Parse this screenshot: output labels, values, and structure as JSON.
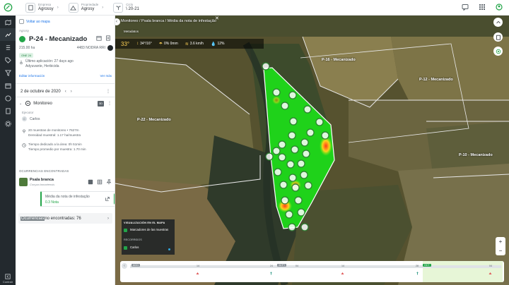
{
  "topbar": {
    "company_label": "Empresa",
    "company_value": "Agrossy",
    "property_label": "Propriedade",
    "property_value": "Agrosy",
    "cycle_label": "Ciclo",
    "cycle_value": "\\ 20-21"
  },
  "leftnav": {
    "collapse_label": "Contrair"
  },
  "panel": {
    "back_label": "Voltar ao mapa",
    "company": "Agrosy",
    "field_name": "P-24 - Mecanizado",
    "area": "215.00 ha",
    "variety": "4483 NODRA RRI",
    "badge": "ONE 24",
    "last_application_label": "Último aplicación: 27 days ago",
    "last_application_detail": "Adyuvante, Herbicida",
    "edit_label": "Editar información",
    "see_more_label": "Ver más",
    "date": "2 de octubre de 2020",
    "monitoring_label": "Monitoreo",
    "monitoring_badge": "3D",
    "executor_label": "Ejecutor",
    "executor_name": "Carlos",
    "executor_initials": "C",
    "stats": [
      {
        "line1": "20 muestras de monitoreo • 7627m",
        "line2": "Densidad muestral: 1.17 ha/muestra"
      },
      {
        "line1": "Tiempo dedicado a la área: 0h 51min",
        "line2": "Tiempo promedio por muestra: 1.70 min"
      }
    ],
    "occurrences_title": "OCURRENCIAS ENCONTRADAS",
    "occurrence_name": "Psala branca",
    "occurrence_sci": "Conyza bonariensis",
    "heat_title": "Média da nota de infestação",
    "heat_value": "0.3 Nota",
    "not_found_highlight": "Ocurrencias",
    "not_found_rest": " no encontradas: 76"
  },
  "map": {
    "breadcrumb": "Monitoreo / Psala branca / Média da nota de infestação",
    "sublabel": "Metadatos",
    "weather": {
      "temp": "33°",
      "wind": "34°/16°",
      "rain": "0% 0mm",
      "speed": "3.6 km/h",
      "humidity": "12%"
    },
    "plots": [
      {
        "id": "p16",
        "label": "P-16 - Mecanizado"
      },
      {
        "id": "p12",
        "label": "P-12 - Mecanizado"
      },
      {
        "id": "p22",
        "label": "P-22 - Mecanizado"
      },
      {
        "id": "p10",
        "label": "P-10 - Mecanizado"
      }
    ],
    "legend": {
      "heading": "VISUALIZACIÓN EN EL MAPA",
      "item1": "Marcadores de las muestras",
      "heading2": "RECORRIDOS",
      "item2": "Carlos"
    },
    "zoom_in": "+",
    "zoom_out": "−"
  },
  "timeline": {
    "tags": [
      "AGO",
      "SEPT",
      "OCT"
    ],
    "numbers": [
      "14",
      "24",
      "04",
      "14",
      "28",
      "04"
    ]
  },
  "colors": {
    "accent": "#23a549",
    "nav_bg": "#23292e",
    "field_green": "#1fd21a"
  }
}
